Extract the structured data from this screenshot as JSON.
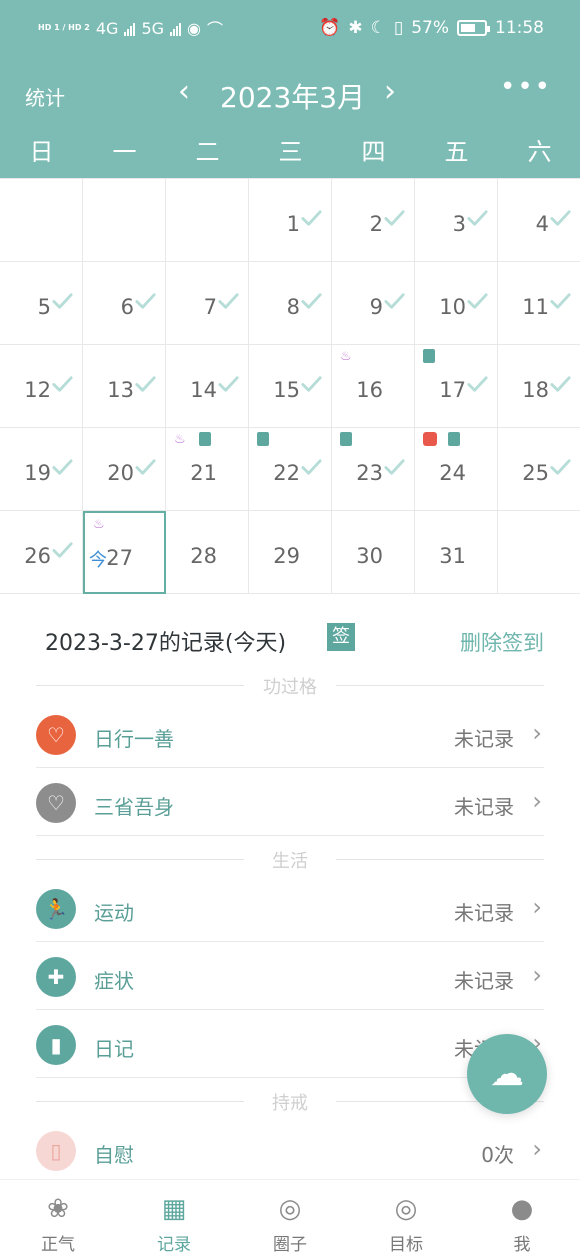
{
  "status_bar": {
    "signal": "HD 1 / HD 2",
    "net_left": "4G",
    "net_right": "5G",
    "battery": "57%",
    "time": "11:58"
  },
  "header": {
    "stat_label": "统计",
    "title": "2023年3月",
    "prev_icon": "chevron-left-icon",
    "next_icon": "chevron-right-icon",
    "more_icon": "more-icon"
  },
  "weekdays": [
    "日",
    "一",
    "二",
    "三",
    "四",
    "五",
    "六"
  ],
  "calendar": {
    "rows": [
      [
        null,
        null,
        null,
        {
          "d": "1",
          "chk": true
        },
        {
          "d": "2",
          "chk": true
        },
        {
          "d": "3",
          "chk": true
        },
        {
          "d": "4",
          "chk": true
        }
      ],
      [
        {
          "d": "5",
          "chk": true
        },
        {
          "d": "6",
          "chk": true
        },
        {
          "d": "7",
          "chk": true
        },
        {
          "d": "8",
          "chk": true
        },
        {
          "d": "9",
          "chk": true
        },
        {
          "d": "10",
          "chk": true
        },
        {
          "d": "11",
          "chk": true
        }
      ],
      [
        {
          "d": "12",
          "chk": true
        },
        {
          "d": "13",
          "chk": true
        },
        {
          "d": "14",
          "chk": true
        },
        {
          "d": "15",
          "chk": true
        },
        {
          "d": "16",
          "chk": false,
          "badges": [
            "yoga"
          ]
        },
        {
          "d": "17",
          "chk": true,
          "badges": [
            "book"
          ]
        },
        {
          "d": "18",
          "chk": true
        }
      ],
      [
        {
          "d": "19",
          "chk": true
        },
        {
          "d": "20",
          "chk": true
        },
        {
          "d": "21",
          "chk": false,
          "badges": [
            "yoga",
            "book"
          ]
        },
        {
          "d": "22",
          "chk": true,
          "badges": [
            "book"
          ]
        },
        {
          "d": "23",
          "chk": true,
          "badges": [
            "book"
          ]
        },
        {
          "d": "24",
          "chk": false,
          "badges": [
            "roll",
            "book"
          ]
        },
        {
          "d": "25",
          "chk": true
        }
      ],
      [
        {
          "d": "26",
          "chk": true
        },
        {
          "d": "27",
          "chk": false,
          "today": true,
          "todayText": "今",
          "badges": [
            "yoga"
          ]
        },
        {
          "d": "28",
          "chk": false
        },
        {
          "d": "29",
          "chk": false
        },
        {
          "d": "30",
          "chk": false
        },
        {
          "d": "31",
          "chk": false
        },
        null
      ]
    ]
  },
  "record": {
    "title": "2023-3-27的记录(今天)",
    "sign_label": "签",
    "delete_label": "删除签到",
    "sections": [
      {
        "name": "功过格",
        "items": [
          {
            "label": "日行一善",
            "value": "未记录",
            "icon": "heart-icon",
            "color": "#e8643f"
          },
          {
            "label": "三省吾身",
            "value": "未记录",
            "icon": "broken-heart-icon",
            "color": "#8d8d8d"
          }
        ]
      },
      {
        "name": "生活",
        "items": [
          {
            "label": "运动",
            "value": "未记录",
            "icon": "running-icon",
            "color": "#5ea79f"
          },
          {
            "label": "症状",
            "value": "未记录",
            "icon": "medkit-icon",
            "color": "#5ea79f"
          },
          {
            "label": "日记",
            "value": "未记录",
            "icon": "notebook-icon",
            "color": "#5ea79f"
          }
        ]
      },
      {
        "name": "持戒",
        "items": [
          {
            "label": "自慰",
            "value": "0次",
            "icon": "tissue-icon",
            "color": "#f6d7d3"
          }
        ]
      }
    ]
  },
  "fab": {
    "icon": "cloud-check-icon"
  },
  "tabbar": [
    {
      "label": "正气",
      "icon": "lotus-icon",
      "active": false
    },
    {
      "label": "记录",
      "icon": "calendar-icon",
      "active": true
    },
    {
      "label": "圈子",
      "icon": "circle-icon",
      "active": false
    },
    {
      "label": "目标",
      "icon": "target-icon",
      "active": false
    },
    {
      "label": "我",
      "icon": "user-icon",
      "active": false
    }
  ]
}
